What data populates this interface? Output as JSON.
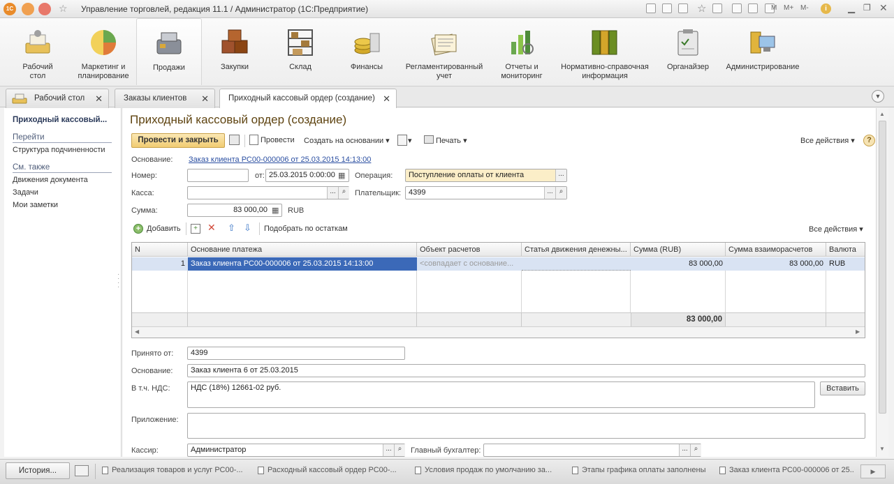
{
  "window": {
    "title": "Управление торговлей, редакция 11.1 / Администратор  (1С:Предприятие)",
    "logo": "1C",
    "m_labels": [
      "M",
      "M+",
      "M-"
    ]
  },
  "sections": [
    {
      "label": "Рабочий\nстол",
      "icon": "desktop-icon",
      "color": "#e8c15a"
    },
    {
      "label": "Маркетинг и\nпланирование",
      "icon": "pie-chart-icon",
      "color": "#6aa84f"
    },
    {
      "label": "Продажи",
      "icon": "cash-register-icon",
      "color": "#8a8f99"
    },
    {
      "label": "Закупки",
      "icon": "boxes-icon",
      "color": "#a0522d"
    },
    {
      "label": "Склад",
      "icon": "warehouse-shelf-icon",
      "color": "#a47a3c"
    },
    {
      "label": "Финансы",
      "icon": "coins-icon",
      "color": "#d4aa2a"
    },
    {
      "label": "Регламентированный\nучет",
      "icon": "documents-icon",
      "color": "#e2c27a"
    },
    {
      "label": "Отчеты и\nмониторинг",
      "icon": "bar-report-icon",
      "color": "#6aa84f"
    },
    {
      "label": "Нормативно-справочная\nинформация",
      "icon": "binders-icon",
      "color": "#6b8e23"
    },
    {
      "label": "Органайзер",
      "icon": "clipboard-icon",
      "color": "#c9c9c9"
    },
    {
      "label": "Администрирование",
      "icon": "admin-computer-icon",
      "color": "#e0b43c"
    }
  ],
  "tabs": [
    {
      "label": "Рабочий стол"
    },
    {
      "label": "Заказы клиентов"
    },
    {
      "label": "Приходный кассовый ордер (создание)"
    }
  ],
  "left_panel": {
    "title": "Приходный кассовый...",
    "goto_header": "Перейти",
    "goto_items": [
      "Структура подчиненности"
    ],
    "see_also_header": "См. также",
    "see_also_items": [
      "Движения документа",
      "Задачи",
      "Мои заметки"
    ]
  },
  "form": {
    "title": "Приходный кассовый ордер (создание)",
    "toolbar": {
      "post_close": "Провести и закрыть",
      "post": "Провести",
      "create_based": "Создать на основании",
      "print": "Печать",
      "all_actions": "Все действия"
    },
    "basis_label": "Основание:",
    "basis_link": "Заказ клиента РС00-000006 от 25.03.2015 14:13:00",
    "number_label": "Номер:",
    "number_value": "",
    "from_label": "от:",
    "date_value": "25.03.2015  0:00:00",
    "operation_label": "Операция:",
    "operation_value": "Поступление оплаты от клиента",
    "cashbox_label": "Касса:",
    "cashbox_value": "",
    "payer_label": "Плательщик:",
    "payer_value": "4399",
    "sum_label": "Сумма:",
    "sum_value": "83 000,00",
    "currency": "RUB"
  },
  "table_toolbar": {
    "add": "Добавить",
    "pick": "Подобрать по остаткам",
    "all_actions": "Все действия"
  },
  "table": {
    "columns": [
      "N",
      "Основание платежа",
      "Объект расчетов",
      "Статья движения денежны...",
      "Сумма (RUB)",
      "Сумма взаиморасчетов",
      "Валюта"
    ],
    "rows": [
      [
        "1",
        "Заказ клиента РС00-000006 от 25.03.2015 14:13:00",
        "<совпадает с основание...",
        "",
        "83 000,00",
        "83 000,00",
        "RUB"
      ]
    ],
    "total": "83 000,00"
  },
  "details": {
    "accepted_label": "Принято от:",
    "accepted_value": "4399",
    "basis_label": "Основание:",
    "basis_value": "Заказ клиента 6 от 25.03.2015",
    "vat_label": "В т.ч. НДС:",
    "vat_value": "НДС (18%) 12661-02 руб.",
    "insert_button": "Вставить",
    "attachment_label": "Приложение:",
    "attachment_value": "",
    "cashier_label": "Кассир:",
    "cashier_value": "Администратор",
    "chief_accountant_label": "Главный бухгалтер:",
    "chief_accountant_value": ""
  },
  "bottom_bar": {
    "history": "История...",
    "items": [
      "Реализация товаров и услуг РС00-...",
      "Расходный кассовый ордер РС00-...",
      "Условия продаж по умолчанию за...",
      "Этапы графика оплаты заполнены",
      "Заказ клиента РС00-000006 от 25..."
    ]
  }
}
